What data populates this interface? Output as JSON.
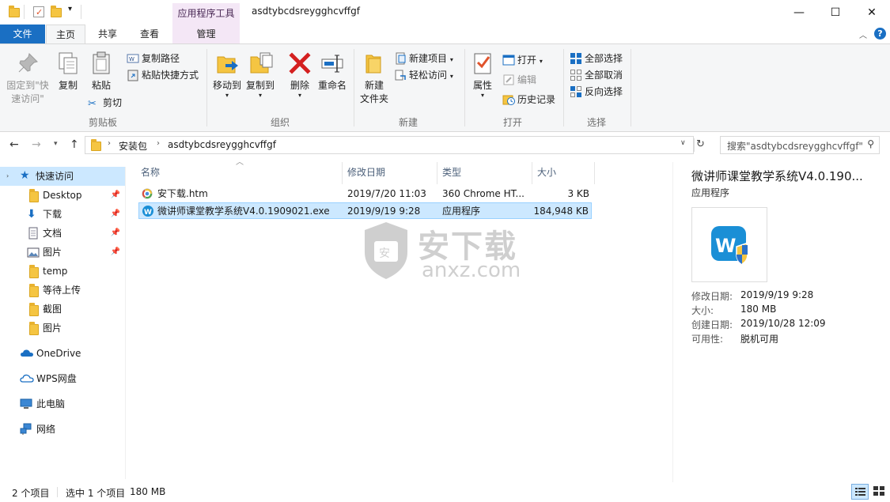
{
  "window": {
    "title": "asdtybcdsreygghcvffgf",
    "context_tab_group": "应用程序工具",
    "controls": {
      "minimize": "—",
      "maximize": "☐",
      "close": "✕"
    }
  },
  "ribbon_tabs": {
    "file": "文件",
    "home": "主页",
    "share": "共享",
    "view": "查看",
    "manage": "管理"
  },
  "ribbon": {
    "clipboard": {
      "label": "剪贴板",
      "pin_quick_access_1": "固定到\"快",
      "pin_quick_access_2": "速访问\"",
      "copy": "复制",
      "paste": "粘贴",
      "copy_path": "复制路径",
      "paste_shortcut": "粘贴快捷方式",
      "cut": "剪切"
    },
    "organize": {
      "label": "组织",
      "move_to": "移动到",
      "copy_to": "复制到",
      "delete": "删除",
      "rename": "重命名"
    },
    "new": {
      "label": "新建",
      "new_folder_1": "新建",
      "new_folder_2": "文件夹",
      "new_item": "新建项目",
      "easy_access": "轻松访问"
    },
    "open": {
      "label": "打开",
      "properties": "属性",
      "open": "打开",
      "edit": "编辑",
      "history": "历史记录"
    },
    "select": {
      "label": "选择",
      "select_all": "全部选择",
      "select_none": "全部取消",
      "invert": "反向选择"
    }
  },
  "address": {
    "crumb_1": "安装包",
    "crumb_2": "asdtybcdsreygghcvffgf",
    "search_placeholder": "搜索\"asdtybcdsreygghcvffgf\""
  },
  "nav": {
    "quick_access": "快速访问",
    "items": [
      {
        "label": "Desktop"
      },
      {
        "label": "下载"
      },
      {
        "label": "文档"
      },
      {
        "label": "图片"
      },
      {
        "label": "temp"
      },
      {
        "label": "等待上传"
      },
      {
        "label": "截图"
      },
      {
        "label": "图片"
      }
    ],
    "onedrive": "OneDrive",
    "wps": "WPS网盘",
    "this_pc": "此电脑",
    "network": "网络"
  },
  "files": {
    "headers": {
      "name": "名称",
      "date": "修改日期",
      "type": "类型",
      "size": "大小"
    },
    "rows": [
      {
        "name": "安下载.htm",
        "date": "2019/7/20 11:03",
        "type": "360 Chrome HT...",
        "size": "3 KB"
      },
      {
        "name": "微讲师课堂教学系统V4.0.1909021.exe",
        "date": "2019/9/19 9:28",
        "type": "应用程序",
        "size": "184,948 KB"
      }
    ]
  },
  "preview": {
    "title": "微讲师课堂教学系统V4.0.190...",
    "subtitle": "应用程序",
    "modified_k": "修改日期:",
    "modified_v": "2019/9/19 9:28",
    "size_k": "大小:",
    "size_v": "180 MB",
    "created_k": "创建日期:",
    "created_v": "2019/10/28 12:09",
    "avail_k": "可用性:",
    "avail_v": "脱机可用"
  },
  "status": {
    "count": "2 个项目",
    "selected": "选中 1 个项目",
    "size": "180 MB"
  },
  "watermark": {
    "text_cn": "安下载",
    "text_en": "anxz.com",
    "badge": "安"
  }
}
